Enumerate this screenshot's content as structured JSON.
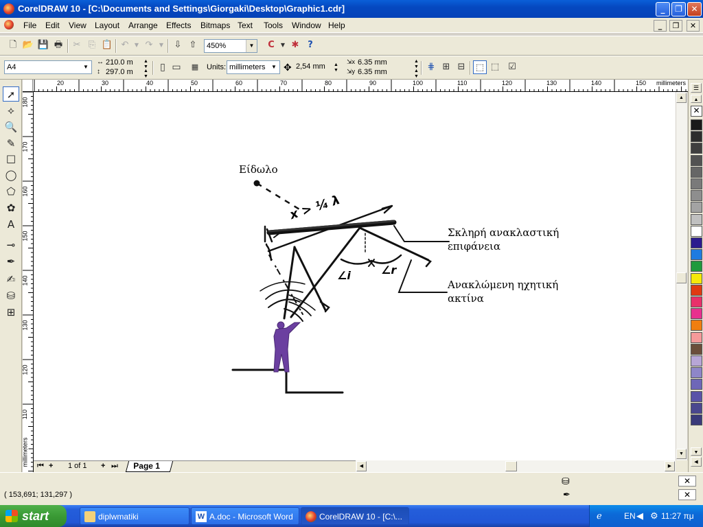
{
  "window": {
    "title": "CorelDRAW 10 - [C:\\Documents and Settings\\Giorgaki\\Desktop\\Graphic1.cdr]"
  },
  "menu": [
    "File",
    "Edit",
    "View",
    "Layout",
    "Arrange",
    "Effects",
    "Bitmaps",
    "Text",
    "Tools",
    "Window",
    "Help"
  ],
  "toolbar": {
    "zoom": "450%"
  },
  "propbar": {
    "paper": "A4",
    "width": "210.0 m",
    "height": "297.0 m",
    "units_label": "Units:",
    "units": "millimeters",
    "nudge": "2,54 mm",
    "dup_x": "6.35 mm",
    "dup_y": "6.35 mm"
  },
  "ruler": {
    "h_ticks": [
      "20",
      "30",
      "40",
      "50",
      "60",
      "70",
      "80",
      "90",
      "100",
      "110",
      "120",
      "130",
      "140",
      "150"
    ],
    "h_unit": "millimeters",
    "v_ticks": [
      "180",
      "170",
      "160",
      "150",
      "140",
      "130",
      "120",
      "110"
    ],
    "v_unit": "millimeters"
  },
  "drawing": {
    "label_image": "Είδωλο",
    "label_surface_1": "Σκληρή ανακλαστική",
    "label_surface_2": "επιφάνεια",
    "label_ray_1": "Ανακλώμενη ηχητική",
    "label_ray_2": "ακτίνα",
    "hand_dist": "x > ¼ λ",
    "hand_ang_i": "∠i",
    "hand_ang_r": "∠r"
  },
  "pagenav": {
    "count": "1 of 1",
    "tab": "Page 1"
  },
  "status": {
    "coords": "( 153,691; 131,297 )"
  },
  "palette_colors": [
    "#1a1a1a",
    "#2d2d2d",
    "#3f3f3f",
    "#525252",
    "#666666",
    "#7a7a7a",
    "#8e8e8e",
    "#a3a3a3",
    "#c0c0c0",
    "#ffffff",
    "#2b1b8e",
    "#1e7be0",
    "#1e9a3c",
    "#f5e90a",
    "#e03a12",
    "#e8306a",
    "#e8308e",
    "#f07e10",
    "#f59a9a",
    "#6b4e3a",
    "#b7a6d6",
    "#8e86c8",
    "#6e67b8",
    "#5a53a8",
    "#4a478f",
    "#3a3a7a"
  ],
  "taskbar": {
    "start": "start",
    "tasks": [
      "diplwmatiki",
      "A.doc - Microsoft Word",
      "CorelDRAW 10 - [C:\\..."
    ],
    "lang": "EN",
    "clock": "11:27 πμ"
  }
}
